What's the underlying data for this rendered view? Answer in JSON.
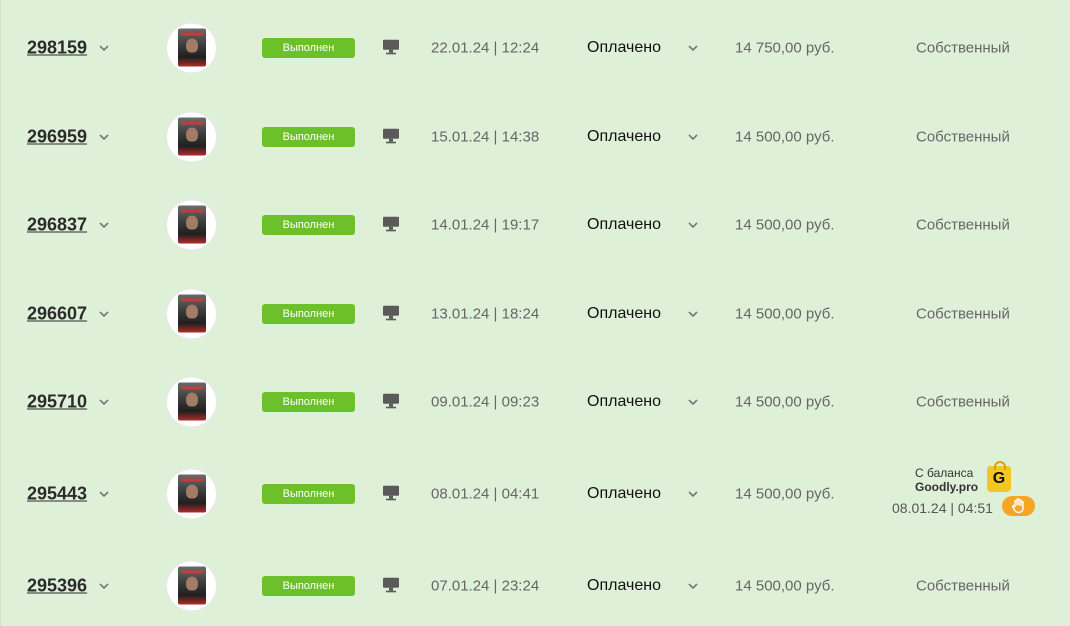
{
  "orders": [
    {
      "id": "298159",
      "status": "Выполнен",
      "date": "22.01.24 | 12:24",
      "payment": "Оплачено",
      "amount": "14 750,00 руб.",
      "source": "Собственный"
    },
    {
      "id": "296959",
      "status": "Выполнен",
      "date": "15.01.24 | 14:38",
      "payment": "Оплачено",
      "amount": "14 500,00 руб.",
      "source": "Собственный"
    },
    {
      "id": "296837",
      "status": "Выполнен",
      "date": "14.01.24 | 19:17",
      "payment": "Оплачено",
      "amount": "14 500,00 руб.",
      "source": "Собственный"
    },
    {
      "id": "296607",
      "status": "Выполнен",
      "date": "13.01.24 | 18:24",
      "payment": "Оплачено",
      "amount": "14 500,00 руб.",
      "source": "Собственный"
    },
    {
      "id": "295710",
      "status": "Выполнен",
      "date": "09.01.24 | 09:23",
      "payment": "Оплачено",
      "amount": "14 500,00 руб.",
      "source": "Собственный"
    },
    {
      "id": "295443",
      "status": "Выполнен",
      "date": "08.01.24 | 04:41",
      "payment": "Оплачено",
      "amount": "14 500,00 руб.",
      "source": "",
      "goodly": {
        "line1": "С баланса",
        "line2": "Goodly.pro",
        "logo_letter": "G",
        "date": "08.01.24 | 04:51"
      }
    },
    {
      "id": "295396",
      "status": "Выполнен",
      "date": "07.01.24 | 23:24",
      "payment": "Оплачено",
      "amount": "14 500,00 руб.",
      "source": "Собственный"
    }
  ],
  "icons": {
    "expand": "chevron-down-icon",
    "device": "monitor-icon",
    "goodly_logo": "shopping-bag-icon",
    "hand": "hand-icon"
  },
  "colors": {
    "background": "#dff0d8",
    "status_badge": "#6cc12a",
    "goodly_logo": "#f3c623",
    "hand_pill": "#f5a623"
  }
}
